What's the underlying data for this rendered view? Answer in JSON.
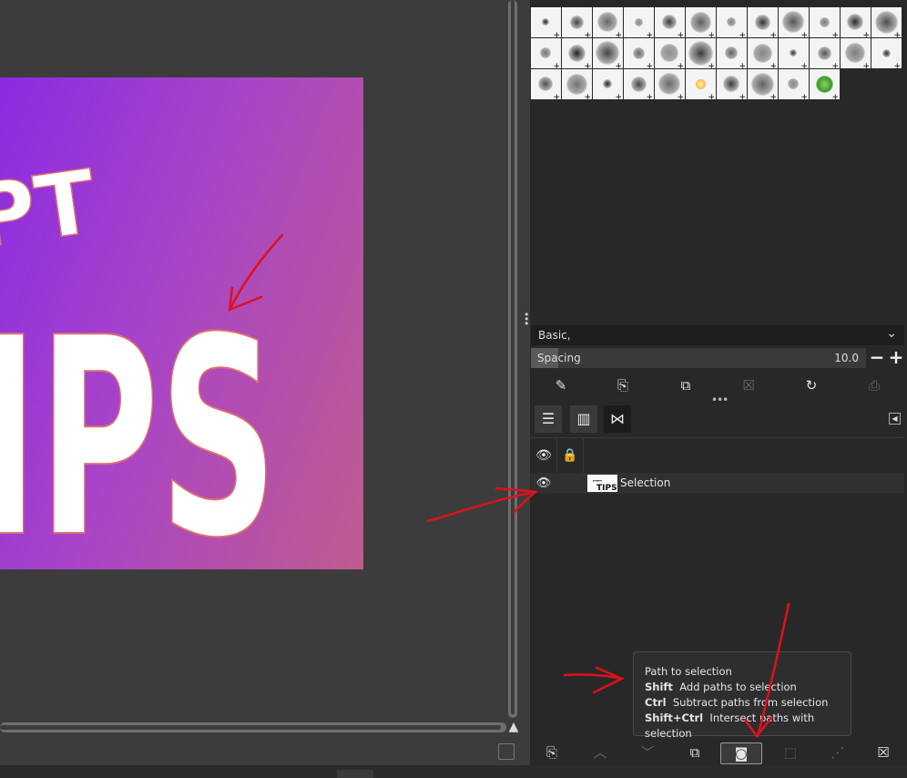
{
  "canvas": {
    "image_text_top": "PT",
    "image_text_main": "IPS"
  },
  "brushes": {
    "preset": "Basic,",
    "spacing_label": "Spacing",
    "spacing_value": "10.0",
    "tiles": 34
  },
  "paths": {
    "row_label": "Selection"
  },
  "tooltip": {
    "title": "Path to selection",
    "lines": [
      {
        "key": "Shift",
        "text": "Add paths to selection"
      },
      {
        "key": "Ctrl",
        "text": "Subtract paths from selection"
      },
      {
        "key": "Shift+Ctrl",
        "text": "Intersect paths with selection"
      }
    ]
  },
  "colors": {
    "annotation": "#e0101c",
    "gradient_start": "#8a2be2",
    "gradient_end": "#bf5c8e"
  }
}
